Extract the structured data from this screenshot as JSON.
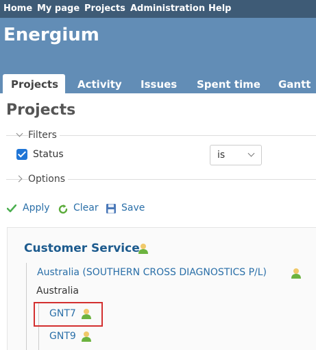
{
  "top_menu": [
    "Home",
    "My page",
    "Projects",
    "Administration",
    "Help"
  ],
  "header": {
    "title": "Energium"
  },
  "tabs": [
    "Projects",
    "Activity",
    "Issues",
    "Spent time",
    "Gantt"
  ],
  "page_title": "Projects",
  "filters": {
    "legend": "Filters",
    "status_label": "Status",
    "status_checked": true,
    "operator": "is",
    "options_legend": "Options"
  },
  "actions": {
    "apply": "Apply",
    "clear": "Clear",
    "save": "Save"
  },
  "projects": {
    "root": "Customer Service",
    "child": "Australia (SOUTHERN CROSS DIAGNOSTICS P/L)",
    "child_label": "Australia",
    "items": [
      "GNT7",
      "GNT9"
    ]
  },
  "colors": {
    "top_menu": "#3e5b76",
    "header": "#628db6",
    "link": "#2a6fa8",
    "highlight": "#d32f2f"
  }
}
